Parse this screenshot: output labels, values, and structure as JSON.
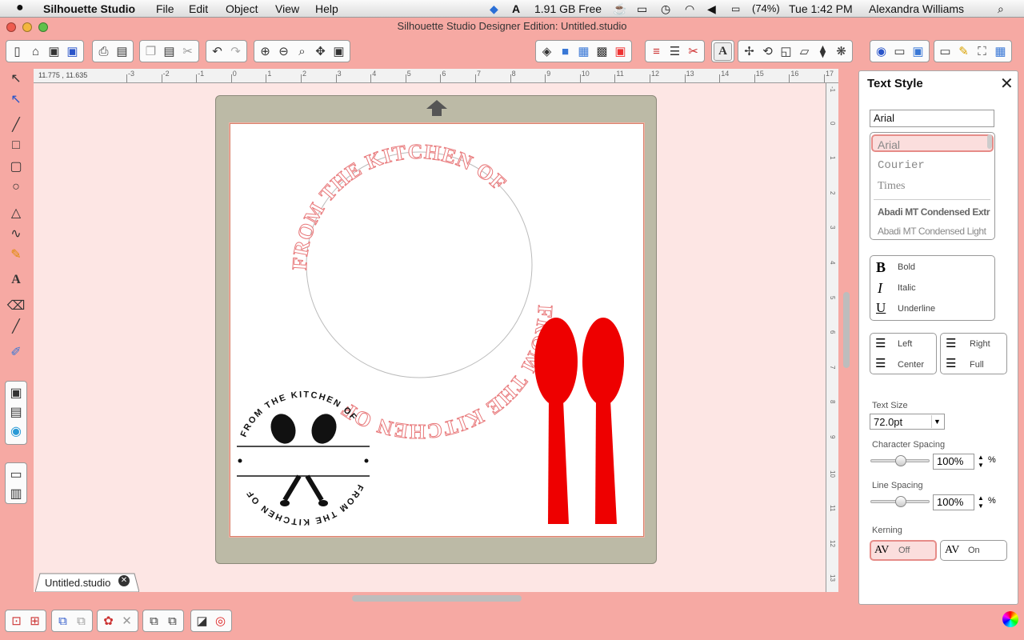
{
  "menu": {
    "apple": "",
    "app": "Silhouette Studio",
    "items": [
      "File",
      "Edit",
      "Object",
      "View",
      "Help"
    ]
  },
  "status_items": {
    "free": "1.91 GB Free",
    "battery": "(74%)",
    "clock": "Tue 1:42 PM",
    "user": "Alexandra Williams"
  },
  "window": {
    "title": "Silhouette Studio Designer Edition: Untitled.studio"
  },
  "ruler": {
    "coords": "11.775 , 11.635",
    "h_ticks": [
      "-3",
      "-2",
      "-1",
      "0",
      "1",
      "2",
      "3",
      "4",
      "5",
      "6",
      "7",
      "8",
      "9",
      "10",
      "11",
      "12",
      "13",
      "14",
      "15",
      "16",
      "17"
    ],
    "v_ticks": [
      "-1",
      "0",
      "1",
      "2",
      "3",
      "4",
      "5",
      "6",
      "7",
      "8",
      "9",
      "10",
      "11",
      "12",
      "13"
    ]
  },
  "canvas": {
    "arc_text_top": "FROM THE KITCHEN OF",
    "arc_text_bottom": "FROM THE KITCHEN OF",
    "emblem_text_top": "FROM THE KITCHEN OF",
    "emblem_text_bottom": "FROM THE KITCHEN OF"
  },
  "panel": {
    "title": "Text Style",
    "font_input": "Arial",
    "fonts": [
      "Arial",
      "Courier",
      "Times",
      "Abadi MT Condensed Extr",
      "Abadi MT Condensed Light"
    ],
    "styles": [
      {
        "glyph": "B",
        "label": "Bold"
      },
      {
        "glyph": "I",
        "label": "Italic"
      },
      {
        "glyph": "U",
        "label": "Underline"
      }
    ],
    "align": [
      {
        "label": "Left"
      },
      {
        "label": "Right"
      },
      {
        "label": "Center"
      },
      {
        "label": "Full"
      }
    ],
    "text_size_label": "Text Size",
    "text_size": "72.0pt",
    "char_spacing_label": "Character Spacing",
    "char_spacing": "100%",
    "line_spacing_label": "Line Spacing",
    "line_spacing": "100%",
    "percent": "%",
    "kerning_label": "Kerning",
    "kerning_glyph": "AV",
    "kerning_off": "Off",
    "kerning_on": "On",
    "char_spacing_level": 0.5,
    "line_spacing_level": 0.5
  },
  "tab": {
    "name": "Untitled.studio"
  },
  "colors": {
    "accent": "#f6a9a3",
    "spoon_red": "#ee0000",
    "arc_text": "#e8787a",
    "mat": "#bcbaa6",
    "emblem": "#111111"
  }
}
